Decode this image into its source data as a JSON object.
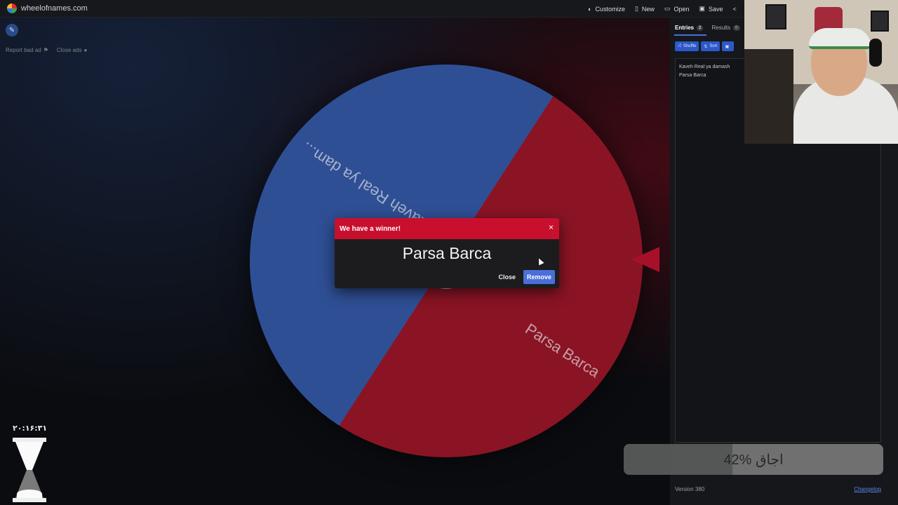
{
  "app": {
    "site": "wheelofnames.com"
  },
  "menu": {
    "customize": "Customize",
    "new": "New",
    "open": "Open",
    "save": "Save"
  },
  "ads": {
    "report": "Report bad ad",
    "close": "Close ads"
  },
  "wheel": {
    "segments": [
      {
        "label": "Kaveh Real ya dam...",
        "color": "#2f4f95"
      },
      {
        "label": "Parsa Barca",
        "color": "#8a1424"
      }
    ]
  },
  "dialog": {
    "title": "We have a winner!",
    "winner": "Parsa Barca",
    "close_label": "Close",
    "remove_label": "Remove",
    "close_icon": "×"
  },
  "panel": {
    "tabs": [
      {
        "label": "Entries",
        "count": "2"
      },
      {
        "label": "Results",
        "count": "0"
      }
    ],
    "toolbar": {
      "shuffle": "Shuffle",
      "sort": "Sort"
    },
    "entries": [
      "Kaveh Real ya damash",
      "Parsa Barca"
    ],
    "version": "Version 380",
    "changelog": "Changelog"
  },
  "overlay": {
    "progress_text": "42% اجاق",
    "progress_value": 0.42,
    "timer": "۲۰:۱۶:۳۱"
  },
  "colors": {
    "accent": "#4a6fd8",
    "winner_header": "#c8102e"
  }
}
